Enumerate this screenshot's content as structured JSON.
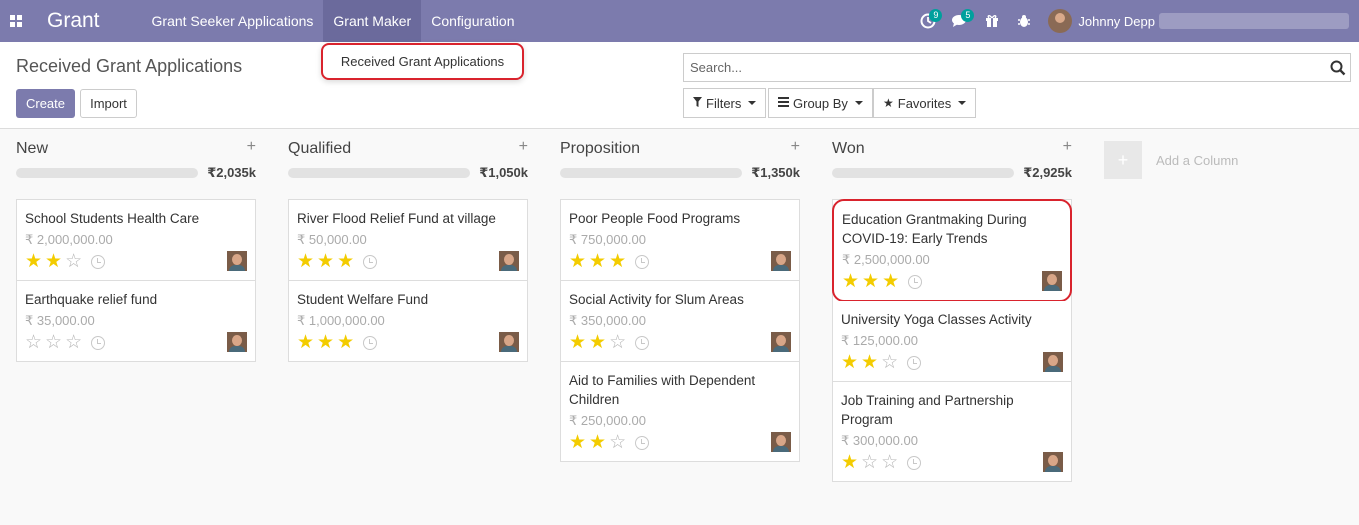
{
  "navbar": {
    "brand": "Grant",
    "menus": [
      "Grant Seeker Applications",
      "Grant Maker",
      "Configuration"
    ],
    "activity_badge": "9",
    "messages_badge": "5",
    "user_name": "Johnny Depp"
  },
  "dropdown": {
    "item": "Received Grant Applications"
  },
  "control": {
    "title": "Received Grant Applications",
    "create_label": "Create",
    "import_label": "Import",
    "search_placeholder": "Search...",
    "filters_label": "Filters",
    "groupby_label": "Group By",
    "favorites_label": "Favorites"
  },
  "columns": [
    {
      "title": "New",
      "total": "₹2,035k",
      "cards": [
        {
          "title": "School Students Health Care",
          "amount": "₹ 2,000,000.00",
          "stars": 2
        },
        {
          "title": "Earthquake relief fund",
          "amount": "₹ 35,000.00",
          "stars": 0
        }
      ]
    },
    {
      "title": "Qualified",
      "total": "₹1,050k",
      "cards": [
        {
          "title": "River Flood Relief Fund at village",
          "amount": "₹ 50,000.00",
          "stars": 3
        },
        {
          "title": "Student Welfare Fund",
          "amount": "₹ 1,000,000.00",
          "stars": 3
        }
      ]
    },
    {
      "title": "Proposition",
      "total": "₹1,350k",
      "cards": [
        {
          "title": "Poor People Food Programs",
          "amount": "₹ 750,000.00",
          "stars": 3
        },
        {
          "title": "Social Activity for Slum Areas",
          "amount": "₹ 350,000.00",
          "stars": 2
        },
        {
          "title": "Aid to Families with Dependent Children",
          "amount": "₹ 250,000.00",
          "stars": 2
        }
      ]
    },
    {
      "title": "Won",
      "total": "₹2,925k",
      "cards": [
        {
          "title": "Education Grantmaking During COVID-19: Early Trends",
          "amount": "₹ 2,500,000.00",
          "stars": 3,
          "highlight": true
        },
        {
          "title": "University Yoga Classes Activity",
          "amount": "₹ 125,000.00",
          "stars": 2
        },
        {
          "title": "Job Training and Partnership Program",
          "amount": "₹ 300,000.00",
          "stars": 1
        }
      ]
    }
  ],
  "add_column_label": "Add a Column",
  "colors": {
    "nav": "#7c7bad",
    "accent": "#7c7bad",
    "star": "#f3cc00",
    "highlight": "#d9232d",
    "badge": "#00a09d"
  }
}
